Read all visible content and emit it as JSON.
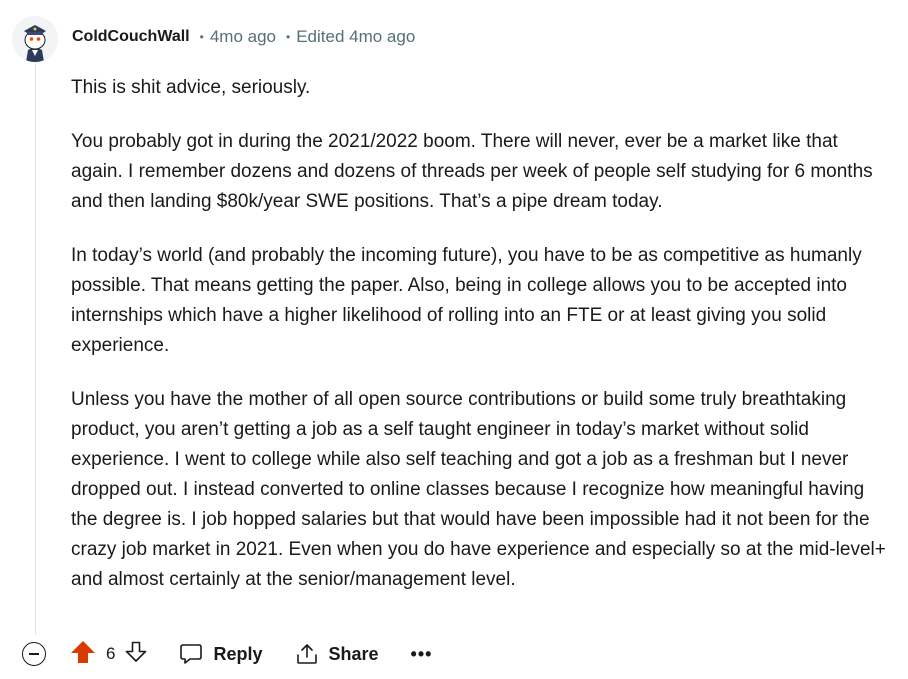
{
  "comment": {
    "author": "ColdCouchWall",
    "posted": "4mo ago",
    "edited": "Edited 4mo ago",
    "separator": "•",
    "paragraphs": [
      "This is shit advice, seriously.",
      "You probably got in during the 2021/2022 boom. There will never, ever be a market like that again. I remember dozens and dozens of threads per week of people self studying for 6 months and then landing $80k/year SWE positions. That’s a pipe dream today.",
      "In today’s world (and probably the incoming future), you have to be as competitive as humanly possible. That means getting the paper. Also, being in college allows you to be accepted into internships which have a higher likelihood of rolling into an FTE or at least giving you solid experience.",
      "Unless you have the mother of all open source contributions or build some truly breathtaking product, you aren’t getting a job as a self taught engineer in today’s market without solid experience. I went to college while also self teaching and got a job as a freshman but I never dropped out. I instead converted to online classes because I recognize how meaningful having the degree is. I job hopped salaries but that would have been impossible had it not been for the crazy job market in 2021. Even when you do have experience and especially so at the mid-level+ and almost certainly at the senior/management level."
    ]
  },
  "actions": {
    "vote_count": "6",
    "reply_label": "Reply",
    "share_label": "Share",
    "more_label": "•••"
  },
  "icons": {
    "avatar": "snoo-avatar",
    "collapse": "collapse-icon",
    "upvote": "upvote-icon",
    "downvote": "downvote-icon",
    "reply": "reply-icon",
    "share": "share-icon"
  },
  "colors": {
    "upvote_active": "#d93a00",
    "meta_text": "#576f76",
    "thread_line": "#e0e3e5"
  }
}
